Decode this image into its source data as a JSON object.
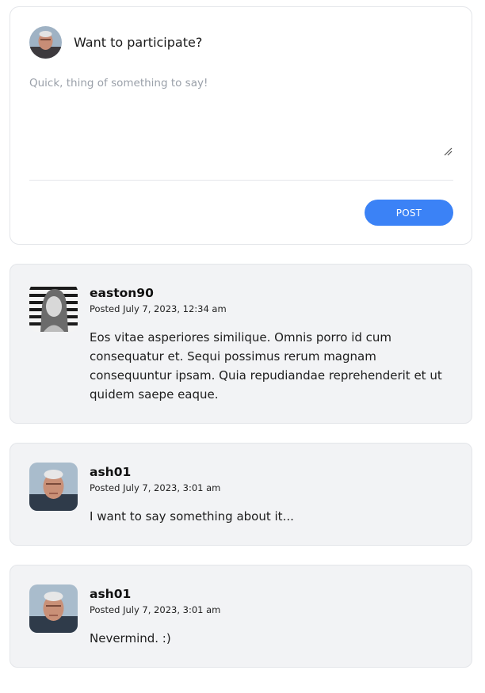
{
  "composer": {
    "title": "Want to participate?",
    "placeholder": "Quick, thing of something to say!",
    "post_label": "POST",
    "accent_color": "#3b82f6"
  },
  "comments": [
    {
      "author": "easton90",
      "date": "Posted July 7, 2023, 12:34 am",
      "body": "Eos vitae asperiores similique. Omnis porro id cum consequatur et. Sequi possimus rerum magnam consequuntur ipsam. Quia repudiandae reprehenderit et ut quidem saepe eaque."
    },
    {
      "author": "ash01",
      "date": "Posted July 7, 2023, 3:01 am",
      "body": "I want to say something about it..."
    },
    {
      "author": "ash01",
      "date": "Posted July 7, 2023, 3:01 am",
      "body": "Nevermind. :)"
    }
  ]
}
